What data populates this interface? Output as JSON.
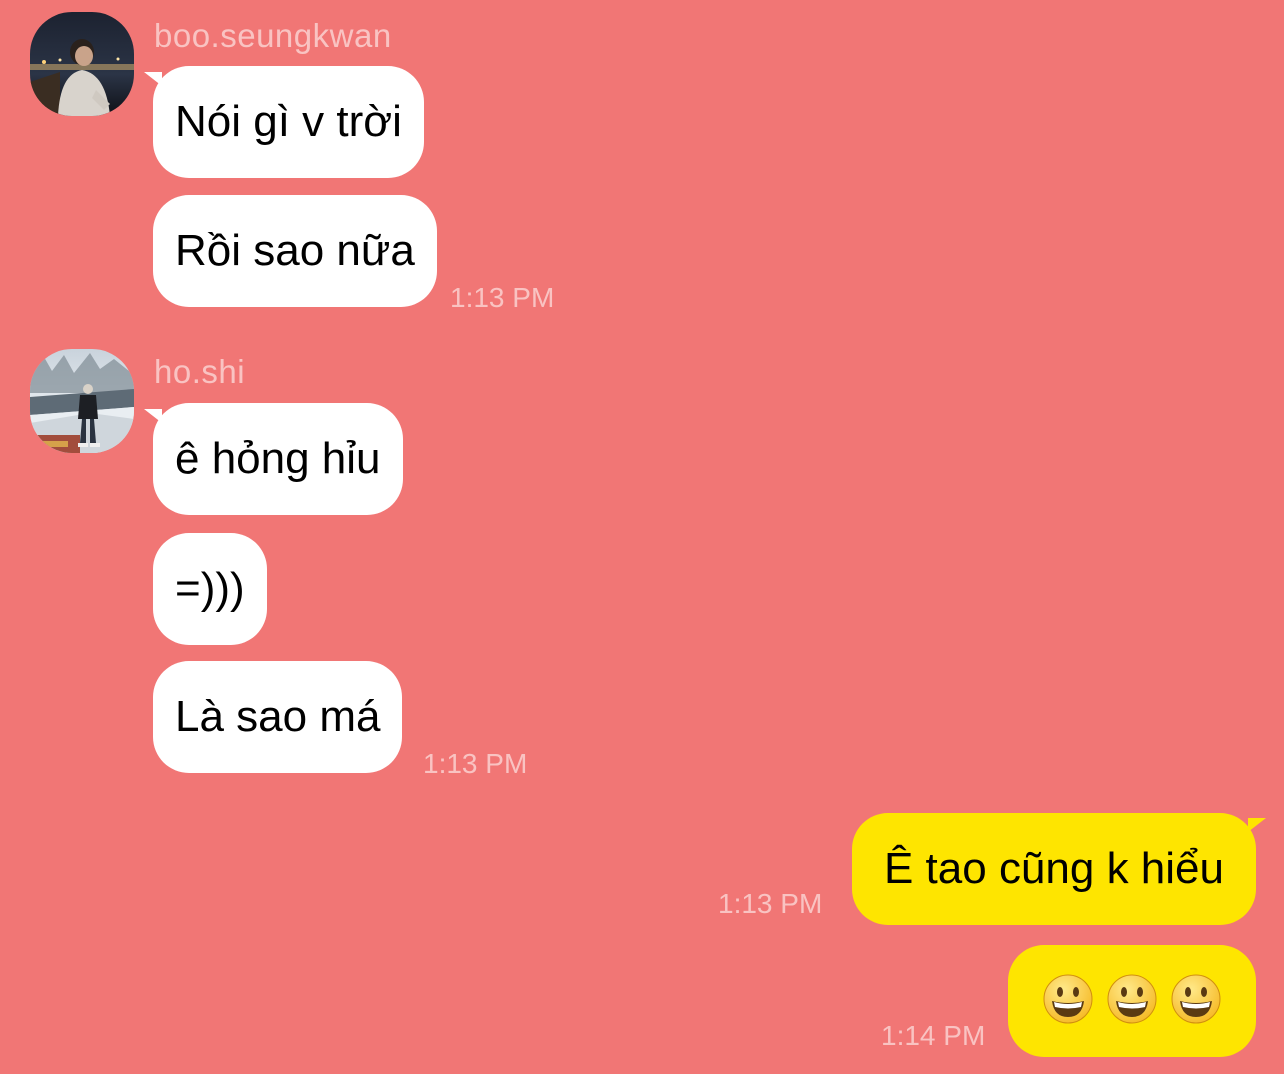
{
  "colors": {
    "background": "#f17675",
    "incoming_bubble": "#ffffff",
    "outgoing_bubble": "#fee500",
    "meta_text": "#f9c3c2"
  },
  "groups": [
    {
      "sender": "boo.seungkwan",
      "avatar_icon": "profile-photo-night-city",
      "messages": [
        "Nói gì v trời",
        "Rồi sao nữa"
      ],
      "time": "1:13 PM"
    },
    {
      "sender": "ho.shi",
      "avatar_icon": "profile-photo-snow-path",
      "messages": [
        "ê hỏng hỉu",
        "=)))",
        "Là sao má"
      ],
      "time": "1:13 PM"
    }
  ],
  "outgoing": [
    {
      "text": "Ê tao cũng k hiểu",
      "time": "1:13 PM"
    },
    {
      "emoji_icons": [
        "grinning-face-emoji",
        "grinning-face-emoji",
        "grinning-face-emoji"
      ],
      "time": "1:14 PM"
    }
  ]
}
